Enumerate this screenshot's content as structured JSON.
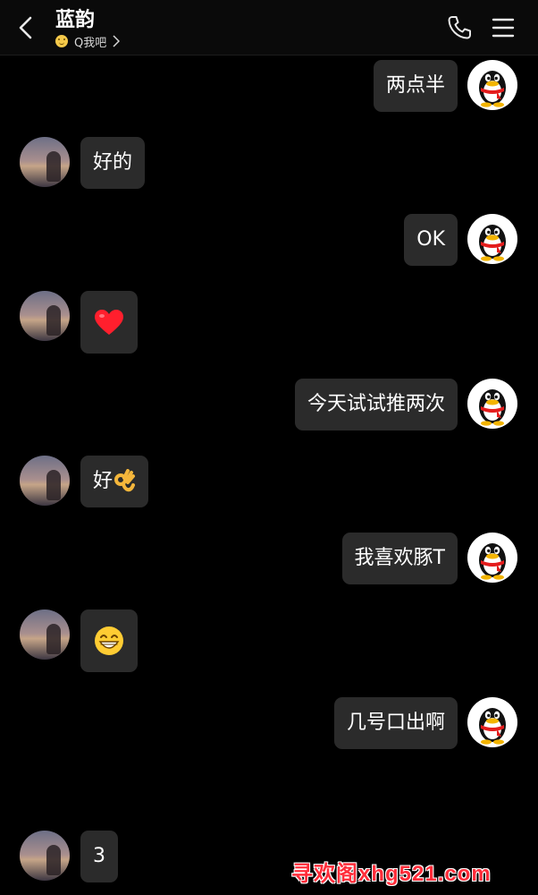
{
  "header": {
    "title": "蓝韵",
    "subtitle": "Q我吧",
    "icons": [
      "back-arrow-icon",
      "phone-icon",
      "menu-icon"
    ]
  },
  "messages": [
    {
      "sender": "me",
      "text": "两点半"
    },
    {
      "sender": "them",
      "text": "好的"
    },
    {
      "sender": "me",
      "text": "OK"
    },
    {
      "sender": "them",
      "emoji": "red-heart"
    },
    {
      "sender": "me",
      "text": "今天试试推两次"
    },
    {
      "sender": "them",
      "text": "好",
      "emoji": "ok-hand"
    },
    {
      "sender": "me",
      "text": "我喜欢豚T"
    },
    {
      "sender": "them",
      "emoji": "grinning-face"
    },
    {
      "sender": "me",
      "text": "几号口出啊"
    },
    {
      "sender": "them",
      "text": "3"
    }
  ],
  "watermark": "寻欢阁xhg521.com",
  "colors": {
    "background": "#000000",
    "bubble": "#2b2b2b",
    "header": "#0a0a0a",
    "watermark": "#ff2d3a"
  }
}
